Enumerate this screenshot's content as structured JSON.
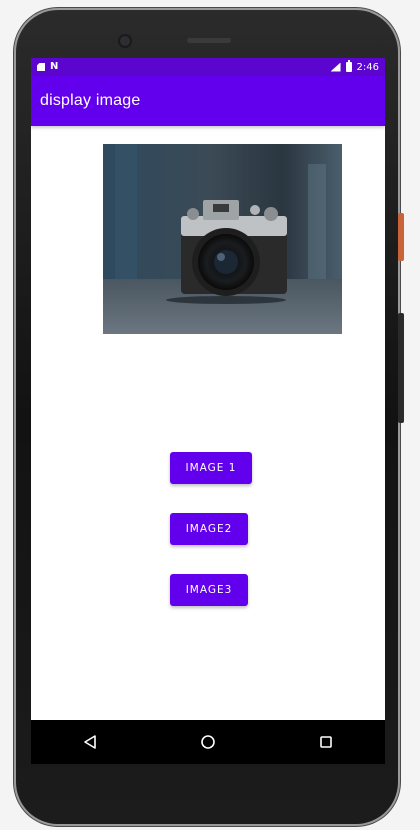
{
  "status_bar": {
    "time": "2:46",
    "left_icons": [
      "sim-icon",
      "n-icon"
    ],
    "right_icons": [
      "signal-icon",
      "battery-icon"
    ],
    "n_label": "N",
    "background": "#5b05cf"
  },
  "app_bar": {
    "title": "display image",
    "background": "#6200ee"
  },
  "main": {
    "image_description_icon": "camera-photo",
    "buttons": [
      {
        "label": "IMAGE 1"
      },
      {
        "label": "IMAGE2"
      },
      {
        "label": "IMAGE3"
      }
    ],
    "accent": "#6200ee"
  },
  "nav_bar": {
    "buttons": [
      "back-icon",
      "home-icon",
      "recents-icon"
    ]
  }
}
